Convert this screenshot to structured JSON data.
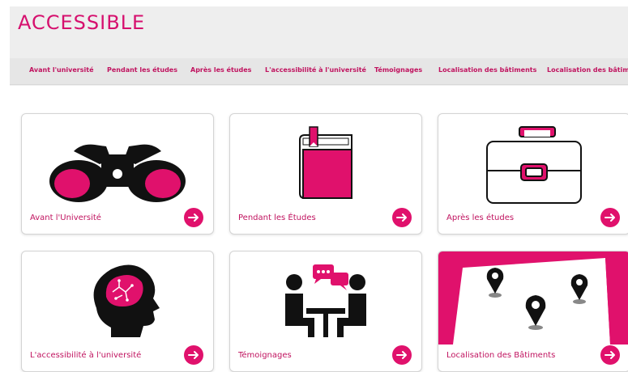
{
  "site": {
    "title": "ACCESSIBLE"
  },
  "nav": {
    "items": [
      "Avant l'université",
      "Pendant les études",
      "Après les études",
      "L'accessibilité à l'université",
      "Témoignages",
      "Localisation des bâtiments",
      "Localisation des bâtiments"
    ]
  },
  "cards": [
    {
      "label": "Avant l'Université",
      "icon": "binoculars-icon"
    },
    {
      "label": "Pendant les Études",
      "icon": "book-icon"
    },
    {
      "label": "Après les études",
      "icon": "briefcase-icon"
    },
    {
      "label": "L'accessibilité à l'université",
      "icon": "brain-head-icon"
    },
    {
      "label": "Témoignages",
      "icon": "people-talking-icon"
    },
    {
      "label": "Localisation des Bâtiments",
      "icon": "map-pins-icon"
    }
  ],
  "colors": {
    "accent": "#e0116c",
    "nav_text": "#c0135f",
    "header_bg": "#eeeeee"
  }
}
